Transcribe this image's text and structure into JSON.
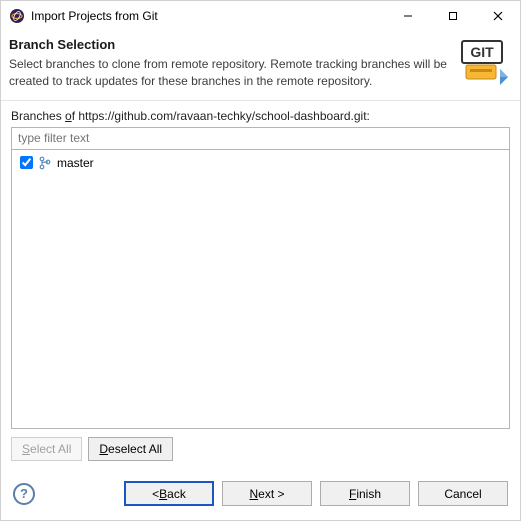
{
  "titlebar": {
    "title": "Import Projects from Git"
  },
  "header": {
    "heading": "Branch Selection",
    "description": "Select branches to clone from remote repository. Remote tracking branches will be created to track updates for these branches in the remote repository."
  },
  "content": {
    "branches_label_pre": "Branches ",
    "branches_label_mn": "o",
    "branches_label_post": "f https://github.com/ravaan-techky/school-dashboard.git:",
    "filter_placeholder": "type filter text",
    "branches": [
      {
        "name": "master",
        "checked": true
      }
    ],
    "select_all_mn": "S",
    "select_all_rest": "elect All",
    "deselect_all_mn": "D",
    "deselect_all_rest": "eselect All"
  },
  "footer": {
    "help": "?",
    "back_pre": "< ",
    "back_mn": "B",
    "back_post": "ack",
    "next_mn": "N",
    "next_post": "ext >",
    "finish_mn": "F",
    "finish_post": "inish",
    "cancel": "Cancel"
  }
}
